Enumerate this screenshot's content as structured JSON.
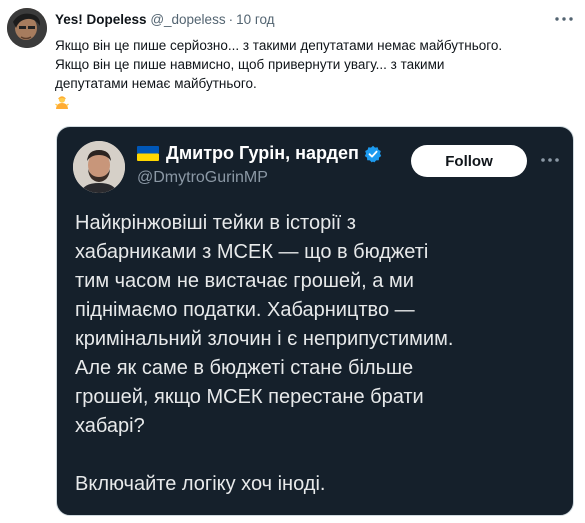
{
  "post": {
    "author_name": "Yes! Dopeless",
    "author_handle": "@_dopeless",
    "separator": "·",
    "timestamp": "10 год",
    "lines": [
      "Якщо він це пише серйозно... з такими депутатами немає майбутнього.",
      "Якщо він це пише навмисно, щоб привернути увагу... з такими",
      "депутатами немає майбутнього."
    ],
    "emoji_icon": "person-shrugging-emoji",
    "more_icon": "more-horizontal-icon"
  },
  "quoted": {
    "author_name": "Дмитро Гурін, нардеп",
    "author_handle": "@DmytroGurinMP",
    "follow_label": "Follow",
    "flag_icon": "ukraine-flag-icon",
    "verified_icon": "verified-badge-icon",
    "lines": [
      "Найкрінжовіші тейки в історії з",
      "хабарниками з МСЕК — що в бюджеті",
      "тим часом не вистачає грошей, а ми",
      "піднімаємо податки. Хабарництво —",
      "кримінальний злочин і є неприпустимим.",
      "Але як саме в бюджеті стане більше",
      "грошей, якщо МСЕК перестане брати",
      "хабарі?"
    ],
    "closing_line": "Включайте логіку хоч іноді."
  },
  "colors": {
    "verified": "#1d9bf0",
    "quote_bg": "#15202b",
    "muted": "#536471"
  }
}
